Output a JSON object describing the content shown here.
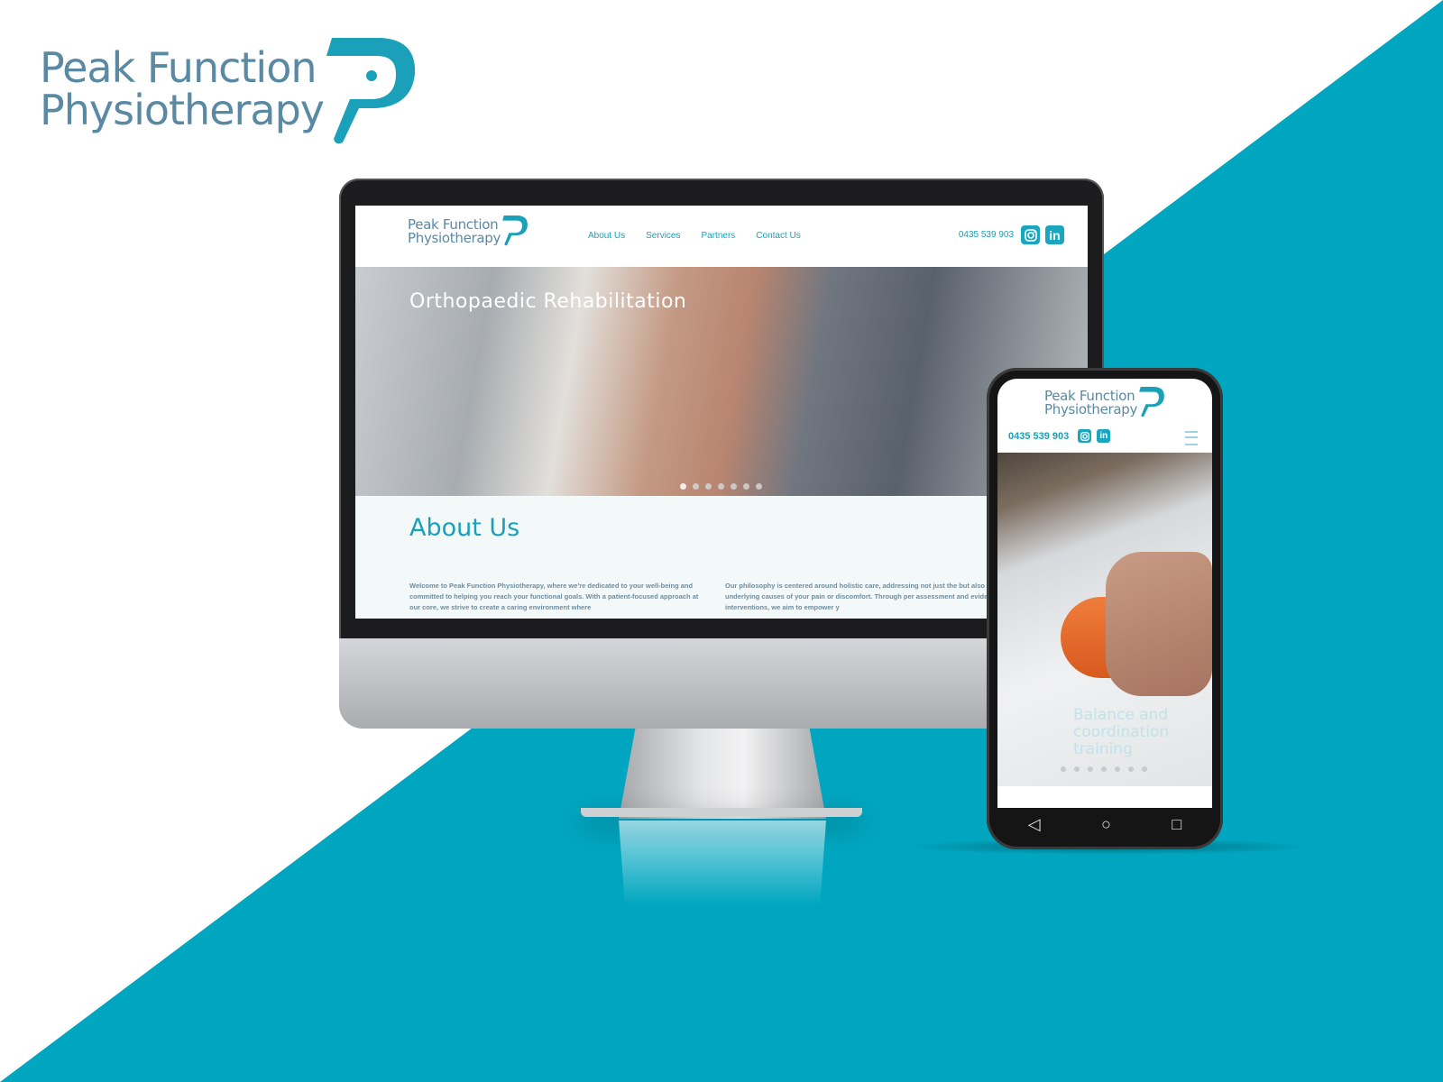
{
  "brand": {
    "line1": "Peak Function",
    "line2": "Physiotherapy",
    "accent_color": "#1aa0b8",
    "teal_bg": "#00a6c0"
  },
  "desktop_site": {
    "logo_line1": "Peak Function",
    "logo_line2": "Physiotherapy",
    "nav": [
      "About Us",
      "Services",
      "Partners",
      "Contact Us"
    ],
    "phone": "0435 539 903",
    "social_icons": [
      "instagram-icon",
      "linkedin-icon"
    ],
    "hero_title": "Orthopaedic Rehabilitation",
    "slider_dots": 7,
    "slider_active": 1,
    "about_heading": "About Us",
    "about_col1": "Welcome to Peak Function Physiotherapy, where we're dedicated to your well-being and committed to helping you reach your functional goals. With a patient-focused approach at our core, we strive to create a caring environment where",
    "about_col2": "Our philosophy is centered around holistic care, addressing not just the but also the underlying causes of your pain or discomfort. Through per assessment and evidence-based interventions, we aim to empower y"
  },
  "mobile_site": {
    "logo_line1": "Peak Function",
    "logo_line2": "Physiotherapy",
    "phone": "0435 539 903",
    "social_icons": [
      "instagram-icon",
      "linkedin-icon"
    ],
    "menu_icon": "hamburger-menu-icon",
    "hero_title_lines": [
      "Balance and",
      "coordination",
      "training"
    ],
    "slider_dots": 7,
    "nav_buttons": [
      "back-icon",
      "home-icon",
      "recents-icon"
    ]
  }
}
